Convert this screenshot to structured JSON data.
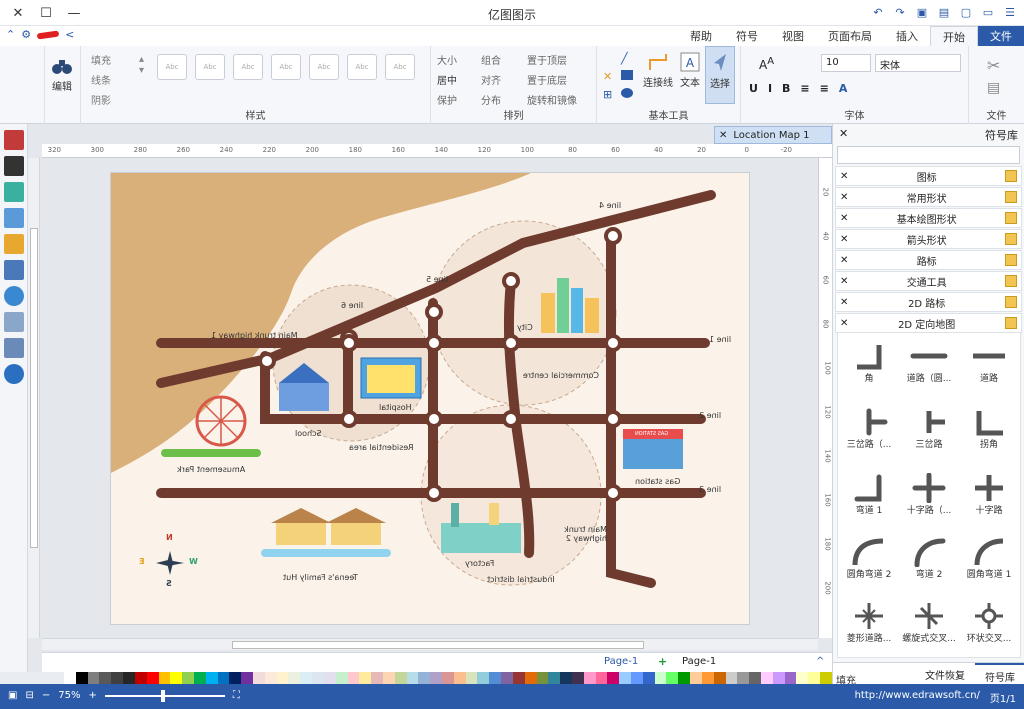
{
  "window": {
    "title": "亿图图示"
  },
  "tabs": [
    {
      "label": "文件"
    },
    {
      "label": "开始"
    },
    {
      "label": "插入"
    },
    {
      "label": "页面布局"
    },
    {
      "label": "视图"
    },
    {
      "label": "符号"
    },
    {
      "label": "帮助"
    }
  ],
  "ribbon": {
    "groups": {
      "file": "文件",
      "font": "字体",
      "basic_tools": "基本工具",
      "arrange": "排列",
      "style": "样式",
      "edit": "编辑"
    },
    "font": {
      "name": "宋体",
      "size": "10"
    },
    "tools": {
      "select": "选择",
      "text": "文本",
      "connector": "连接线"
    },
    "arrange": {
      "top": "置于顶层",
      "bottom": "置于底层",
      "rotate": "旋转和镜像",
      "group": "组合",
      "align": "对齐",
      "distribute": "分布",
      "size": "大小",
      "center": "居中",
      "protect": "保护"
    },
    "style_items": {
      "fill": "填充",
      "line": "线条",
      "shadow": "阴影"
    },
    "style_sample": "Abc",
    "edit_btn": "编辑"
  },
  "document": {
    "tab_label": "Location Map 1"
  },
  "ruler": {
    "h_ticks": [
      "-20",
      "0",
      "20",
      "40",
      "60",
      "80",
      "100",
      "120",
      "140",
      "160",
      "180",
      "200",
      "220",
      "240",
      "260",
      "280",
      "300",
      "320"
    ],
    "v_ticks": [
      "20",
      "40",
      "60",
      "80",
      "100",
      "120",
      "140",
      "160",
      "180",
      "200"
    ]
  },
  "map": {
    "lines": {
      "line1": "line 1",
      "line2": "line 2",
      "line3": "line 3",
      "line4": "line 4",
      "line5": "line 5",
      "line6": "line 6"
    },
    "highway1": "Main trunk highway 1",
    "highway2": "Main trunk highway 2",
    "places": {
      "city": "City",
      "commercial": "Commercial centre",
      "hospital": "Hospital",
      "school": "School",
      "residential": "Residential area",
      "amusement": "Amusement Park",
      "gas_station": "Gas station",
      "gas_sign": "GAS STATION",
      "factory": "Factory",
      "industrial": "Industrial district",
      "hut": "Teena's Family Hut"
    },
    "compass": {
      "n": "N",
      "s": "S",
      "e": "E",
      "w": "W"
    }
  },
  "page_tabs": {
    "page1": "Page-1",
    "page1_active": "Page-1"
  },
  "right_panel": {
    "title": "符号库",
    "libraries": [
      "图标",
      "常用形状",
      "基本绘图形状",
      "箭头形状",
      "路标",
      "交通工具",
      "2D 路标",
      "2D 定向地图"
    ],
    "shapes": [
      {
        "label": "道路"
      },
      {
        "label": "道路（圆..."
      },
      {
        "label": "角"
      },
      {
        "label": "拐角"
      },
      {
        "label": "三岔路"
      },
      {
        "label": "三岔路（..."
      },
      {
        "label": "十字路"
      },
      {
        "label": "十字路（..."
      },
      {
        "label": "弯道 1"
      },
      {
        "label": "圆角弯道 1"
      },
      {
        "label": "弯道 2"
      },
      {
        "label": "圆角弯道 2"
      },
      {
        "label": "环状交叉..."
      },
      {
        "label": "螺旋式交叉..."
      },
      {
        "label": "菱形道路..."
      }
    ],
    "bottom_tabs": [
      "符号库",
      "文件恢复"
    ]
  },
  "palette": {
    "fill_label": "填充",
    "colors": [
      "#ffffff",
      "#000000",
      "#7f7f7f",
      "#595959",
      "#404040",
      "#262626",
      "#c00000",
      "#ff0000",
      "#ffc000",
      "#ffff00",
      "#92d050",
      "#00b050",
      "#00b0f0",
      "#0070c0",
      "#002060",
      "#7030a0",
      "#f2dcdb",
      "#fde9d9",
      "#fff2cc",
      "#ebf1de",
      "#dbeef3",
      "#dce6f1",
      "#e4dfec",
      "#c6efce",
      "#ffc7ce",
      "#ffeb9c",
      "#e6b8b7",
      "#fcd5b4",
      "#c4d79b",
      "#b7dee8",
      "#95b3d7",
      "#b1a0c7",
      "#da9694",
      "#fabf8f",
      "#d8e4bc",
      "#92cddc",
      "#538dd5",
      "#8064a2",
      "#963634",
      "#e26b0a",
      "#76933c",
      "#31869b",
      "#16365c",
      "#403151",
      "#ff99cc",
      "#ff6699",
      "#cc0066",
      "#99ccff",
      "#6699ff",
      "#3366cc",
      "#ccffcc",
      "#66ff66",
      "#009900",
      "#ffcc99",
      "#ff9933",
      "#cc6600",
      "#cccccc",
      "#999999",
      "#666666",
      "#ffccff",
      "#cc99ff",
      "#9966cc",
      "#ffffcc",
      "#ffff99",
      "#cccc00"
    ]
  },
  "status": {
    "url": "http://www.edrawsoft.cn/",
    "page": "页1/1",
    "zoom": "75%"
  }
}
